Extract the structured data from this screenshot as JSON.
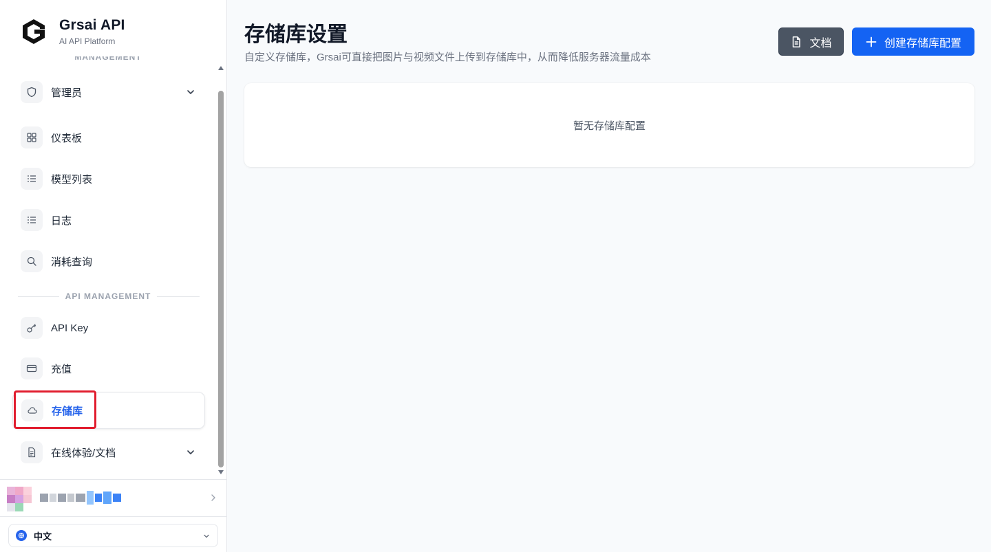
{
  "brand": {
    "name": "Grsai API",
    "subtitle": "AI API Platform"
  },
  "sidebar": {
    "cut_section_label": "MANAGEMENT",
    "api_section_label": "API MANAGEMENT",
    "items": [
      {
        "label": "管理员",
        "icon": "shield-icon",
        "expandable": true
      },
      {
        "label": "仪表板",
        "icon": "dashboard-grid-icon"
      },
      {
        "label": "模型列表",
        "icon": "list-icon"
      },
      {
        "label": "日志",
        "icon": "log-list-icon"
      },
      {
        "label": "消耗查询",
        "icon": "search-icon"
      },
      {
        "label": "API Key",
        "icon": "key-icon"
      },
      {
        "label": "充值",
        "icon": "credit-card-icon"
      },
      {
        "label": "存储库",
        "icon": "cloud-icon",
        "active": true
      },
      {
        "label": "在线体验/文档",
        "icon": "document-icon",
        "expandable": true
      }
    ]
  },
  "language": {
    "label": "中文"
  },
  "page": {
    "title": "存储库设置",
    "description": "自定义存储库，Grsai可直接把图片与视频文件上传到存储库中，从而降低服务器流量成本"
  },
  "toolbar": {
    "doc_label": "文档",
    "create_label": "创建存储库配置"
  },
  "empty_state": {
    "message": "暂无存储库配置"
  },
  "colors": {
    "accent": "#1463f3",
    "active_text": "#2563eb",
    "highlight": "#e11d2e",
    "doc_button": "#4b5563"
  }
}
